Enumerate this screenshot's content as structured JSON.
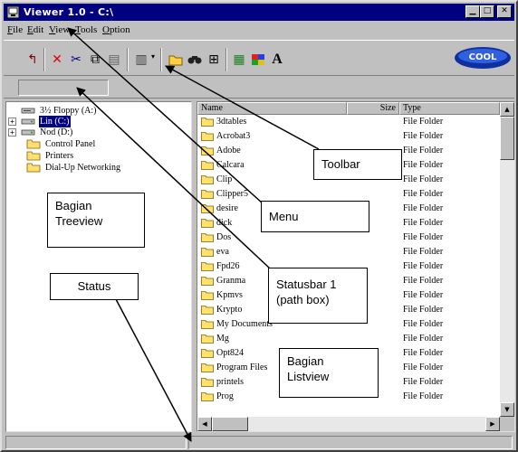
{
  "window": {
    "title": "Viewer 1.0 - C:\\",
    "icon": "viewer-app-icon",
    "caption_buttons": {
      "minimize": "▁",
      "maximize": "□",
      "close": "✕"
    }
  },
  "menubar": {
    "items": [
      {
        "label": "File"
      },
      {
        "label": "Edit"
      },
      {
        "label": "View"
      },
      {
        "label": "Tools"
      },
      {
        "label": "Option"
      }
    ]
  },
  "toolbar": {
    "buttons": [
      {
        "icon": "up-folder-icon",
        "glyph": "↰"
      },
      {
        "icon": "delete-icon",
        "glyph": "✕"
      },
      {
        "icon": "cut-icon",
        "glyph": "✂"
      },
      {
        "icon": "copy-icon",
        "glyph": "⧉"
      },
      {
        "icon": "paste-icon",
        "glyph": "▤"
      },
      {
        "icon": "view-mode-icon",
        "glyph": "▥"
      },
      {
        "icon": "open-folder-icon",
        "glyph": "▭"
      },
      {
        "icon": "find-icon",
        "glyph": "⚲"
      },
      {
        "icon": "properties-icon",
        "glyph": "⊞"
      },
      {
        "icon": "grid-icon",
        "glyph": "▦"
      },
      {
        "icon": "color-palette-icon",
        "glyph": "■"
      },
      {
        "icon": "font-icon",
        "glyph": "A"
      }
    ],
    "logo_text": "COOL"
  },
  "pathbox": {
    "value": ""
  },
  "treeview": {
    "nodes": [
      {
        "label": "3½ Floppy (A:)",
        "icon": "floppy-drive-icon",
        "expander": "",
        "selected": false
      },
      {
        "label": "Lin (C:)",
        "icon": "hard-drive-icon",
        "expander": "+",
        "selected": true
      },
      {
        "label": "Nod (D:)",
        "icon": "hard-drive-icon",
        "expander": "+",
        "selected": false
      },
      {
        "label": "Control Panel",
        "icon": "control-panel-icon",
        "expander": "",
        "selected": false
      },
      {
        "label": "Printers",
        "icon": "printers-folder-icon",
        "expander": "",
        "selected": false
      },
      {
        "label": "Dial-Up Networking",
        "icon": "dialup-folder-icon",
        "expander": "",
        "selected": false
      }
    ]
  },
  "listview": {
    "columns": {
      "name": "Name",
      "size": "Size",
      "type": "Type"
    },
    "rows": [
      {
        "name": "3dtables",
        "type": "File Folder"
      },
      {
        "name": "Acrobat3",
        "type": "File Folder"
      },
      {
        "name": "Adobe",
        "type": "File Folder"
      },
      {
        "name": "Calcara",
        "type": "File Folder"
      },
      {
        "name": "Clip",
        "type": "File Folder"
      },
      {
        "name": "Clipper5",
        "type": "File Folder"
      },
      {
        "name": "desire",
        "type": "File Folder"
      },
      {
        "name": "dick",
        "type": "File Folder"
      },
      {
        "name": "Dos",
        "type": "File Folder"
      },
      {
        "name": "eva",
        "type": "File Folder"
      },
      {
        "name": "Fpd26",
        "type": "File Folder"
      },
      {
        "name": "Granma",
        "type": "File Folder"
      },
      {
        "name": "Kpmvs",
        "type": "File Folder"
      },
      {
        "name": "Krypto",
        "type": "File Folder"
      },
      {
        "name": "My Documents",
        "type": "File Folder"
      },
      {
        "name": "Mg",
        "type": "File Folder"
      },
      {
        "name": "Opt824",
        "type": "File Folder"
      },
      {
        "name": "Program Files",
        "type": "File Folder"
      },
      {
        "name": "printels",
        "type": "File Folder"
      },
      {
        "name": "Prog",
        "type": "File Folder"
      }
    ],
    "scroll_up": "▲",
    "scroll_down": "▼",
    "scroll_left": "◀",
    "scroll_right": "▶"
  },
  "annotations": {
    "toolbar": "Toolbar",
    "menu": "Menu",
    "treeview": "Bagian\nTreeview",
    "statusbar1": "Statusbar 1\n(path box)",
    "status": "Status",
    "listview": "Bagian\nListview"
  },
  "colors": {
    "titlebar": "#000080",
    "face": "#c0c0c0",
    "folder": "#ffe070",
    "selection": "#000080"
  }
}
